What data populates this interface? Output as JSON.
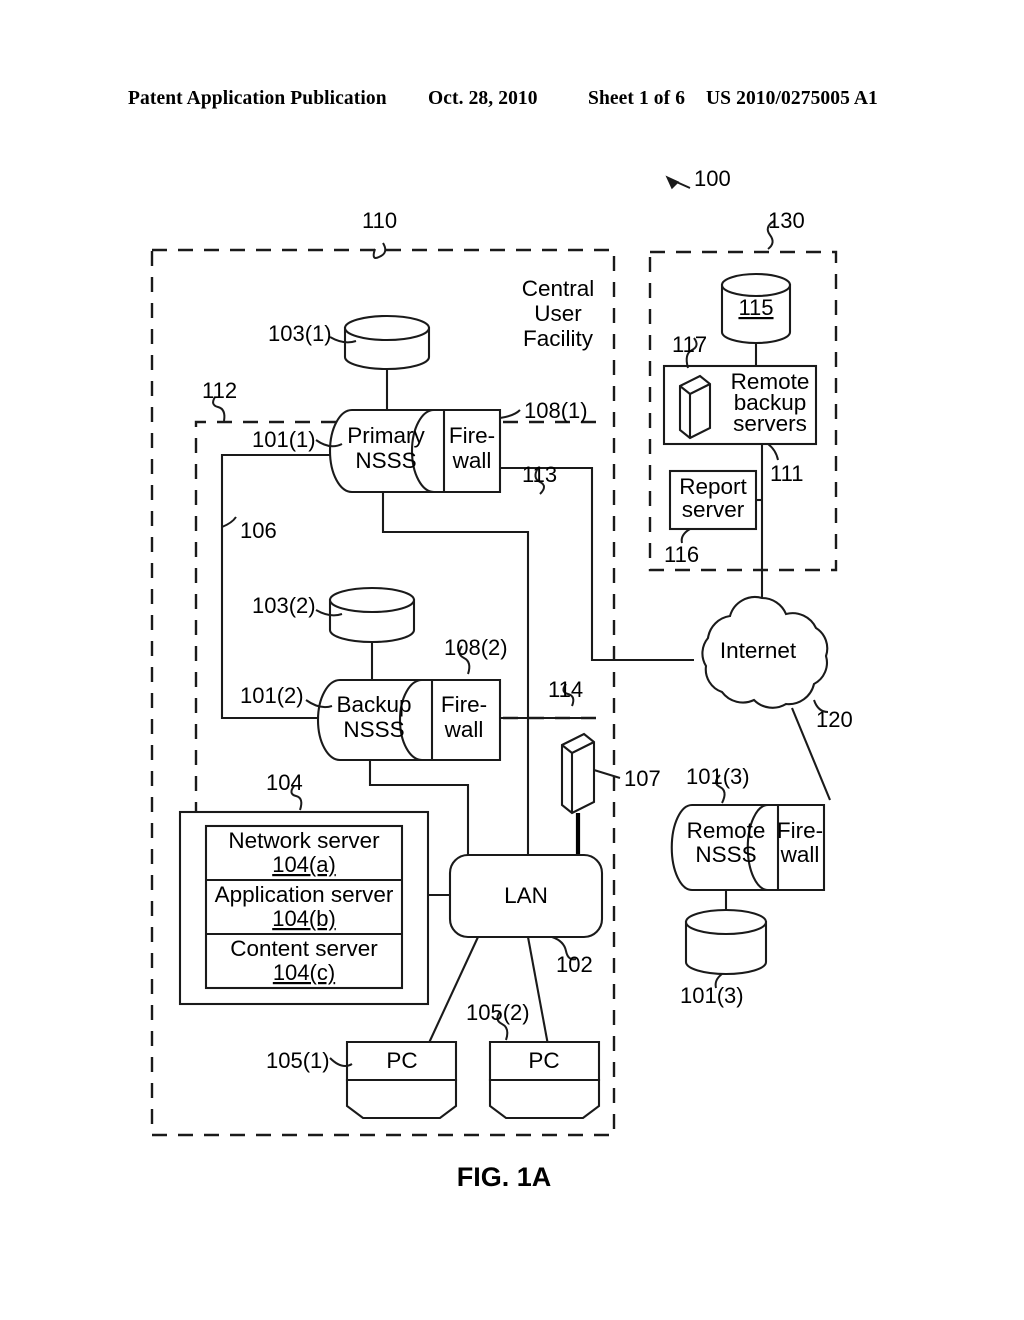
{
  "header": {
    "publication": "Patent Application Publication",
    "date": "Oct. 28, 2010",
    "sheet": "Sheet 1 of 6",
    "patent_number": "US 2010/0275005 A1"
  },
  "figure": {
    "caption": "FIG. 1A",
    "system_ref": "100"
  },
  "regions": {
    "central_user_facility": {
      "title_line1": "Central",
      "title_line2": "User",
      "title_line3": "Facility",
      "ref": "110"
    },
    "inner_dashed": {
      "ref": "112"
    },
    "remote_site": {
      "ref": "130"
    }
  },
  "nodes": {
    "primary_nsss": {
      "line1": "Primary",
      "line2": "NSSS",
      "ref": "101(1)"
    },
    "primary_firewall": {
      "line1": "Fire-",
      "line2": "wall",
      "ref": "108(1)"
    },
    "backup_nsss": {
      "line1": "Backup",
      "line2": "NSSS",
      "ref": "101(2)"
    },
    "backup_firewall": {
      "line1": "Fire-",
      "line2": "wall",
      "ref": "108(2)"
    },
    "remote_nsss": {
      "line1": "Remote",
      "line2": "NSSS",
      "ref": "101(3)"
    },
    "remote_firewall": {
      "line1": "Fire-",
      "line2": "wall"
    },
    "remote_nsss_storage": {
      "ref": "101(3)"
    },
    "primary_storage": {
      "ref": "103(1)"
    },
    "backup_storage": {
      "ref": "103(2)"
    },
    "remote_storage": {
      "ref": "115"
    },
    "remote_backup_servers": {
      "line1": "Remote",
      "line2": "backup",
      "line3": "servers",
      "ref": "111",
      "device_ref": "117"
    },
    "report_server": {
      "line1": "Report",
      "line2": "server",
      "ref": "116"
    },
    "internet": {
      "label": "Internet",
      "ref": "120"
    },
    "lan": {
      "label": "LAN",
      "ref": "102"
    },
    "tape_device": {
      "ref": "107"
    },
    "server_stack": {
      "ref": "104",
      "rows": [
        {
          "label": "Network server",
          "ref": "104(a)"
        },
        {
          "label": "Application server",
          "ref": "104(b)"
        },
        {
          "label": "Content server",
          "ref": "104(c)"
        }
      ]
    },
    "pc1": {
      "label": "PC",
      "ref": "105(1)"
    },
    "pc2": {
      "label": "PC",
      "ref": "105(2)"
    }
  },
  "links": {
    "primary_to_internet": {
      "ref": "113"
    },
    "backup_link": {
      "ref": "114"
    },
    "nsss_loop": {
      "ref": "106"
    }
  },
  "colors": {
    "ink": "#1a1a1a",
    "paper": "#ffffff"
  }
}
